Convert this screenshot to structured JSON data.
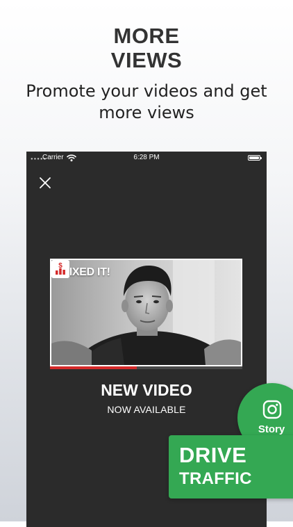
{
  "promo": {
    "headline_line1": "MORE",
    "headline_line2": "VIEWS",
    "subheadline_line1": "Promote your videos and get",
    "subheadline_line2": "more views"
  },
  "status_bar": {
    "carrier": "Carrier",
    "time": "6:28 PM",
    "signal_icon": "signal-dots-icon",
    "wifi_icon": "wifi-icon",
    "battery_icon": "battery-icon"
  },
  "story_card": {
    "close_icon": "close-icon",
    "thumbnail_title": "I FIXED IT!",
    "thumbnail_progress": 0.45,
    "title": "NEW VIDEO",
    "subtitle": "NOW AVAILABLE"
  },
  "share": {
    "instagram_icon": "instagram-icon",
    "story_label": "Story"
  },
  "cta": {
    "line1": "DRIVE",
    "line2": "TRAFFIC"
  },
  "colors": {
    "accent_green": "#34a853",
    "progress_red": "#d42a2a",
    "card_background": "#2b2b2b",
    "headline_text": "#333333"
  }
}
